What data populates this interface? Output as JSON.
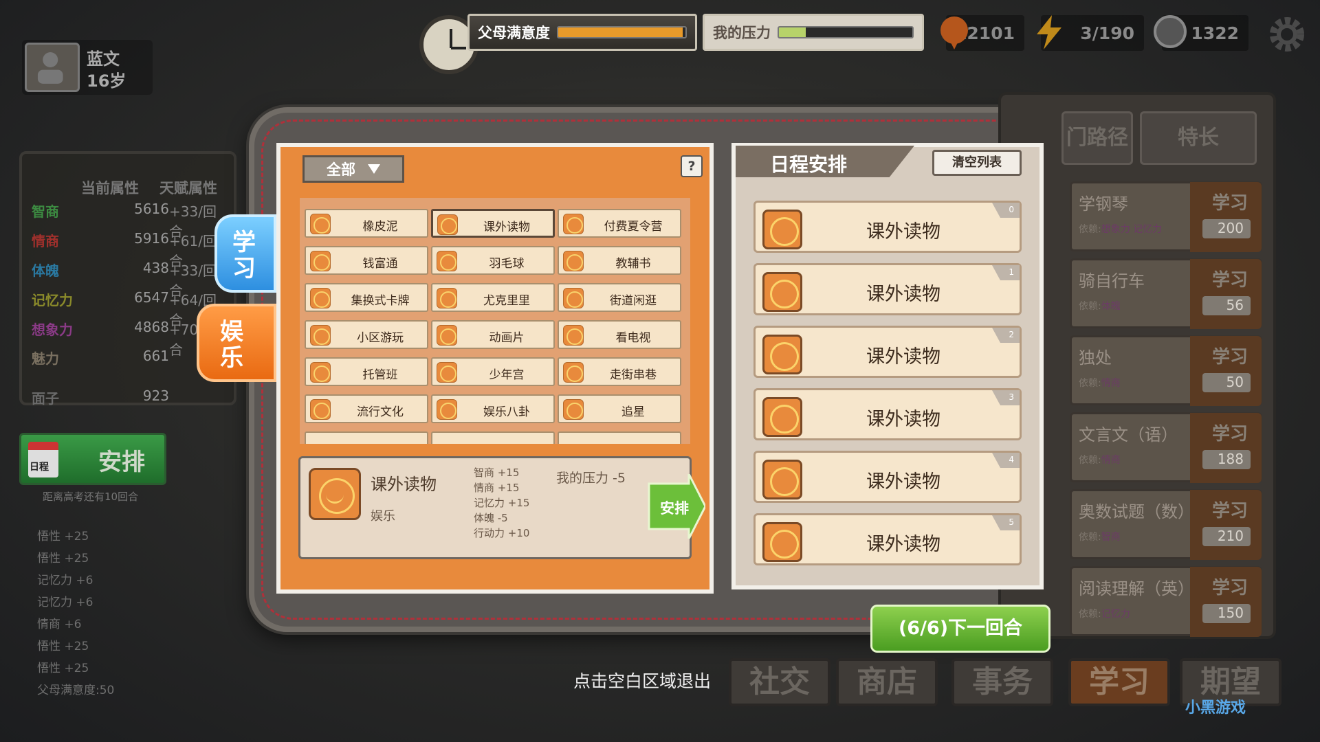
{
  "hud": {
    "parent_label": "父母满意度",
    "parent_level": 0.98,
    "stress_label": "我的压力",
    "stress_level": 0.2,
    "coins": "12101",
    "energy": "3/190",
    "money": "1322"
  },
  "player": {
    "name": "蓝文",
    "age": "16岁"
  },
  "attributes": {
    "col_current": "当前属性",
    "col_talent": "天赋属性",
    "rows": [
      {
        "name": "智商",
        "value": "5616",
        "talent": "+33/回合",
        "color": "#3c8a41"
      },
      {
        "name": "情商",
        "value": "5916",
        "talent": "+61/回合",
        "color": "#a0302c"
      },
      {
        "name": "体魄",
        "value": "438",
        "talent": "+33/回合",
        "color": "#2a78a0"
      },
      {
        "name": "记忆力",
        "value": "6547",
        "talent": "+64/回合",
        "color": "#8a8a2a"
      },
      {
        "name": "想象力",
        "value": "4868",
        "talent": "+70/回合",
        "color": "#8a3a86"
      },
      {
        "name": "魅力",
        "value": "661",
        "talent": "",
        "color": "#7a7060"
      },
      {
        "name": "面子",
        "value": "923",
        "talent": "",
        "color": "#6a6a6a"
      }
    ]
  },
  "arrange": {
    "icon_label": "日程",
    "label": "安排",
    "exam_note": "距离高考还有10回合"
  },
  "log": [
    "悟性 +25",
    "悟性 +25",
    "记忆力 +6",
    "记忆力 +6",
    "情商 +6",
    "悟性 +25",
    "悟性 +25",
    "父母满意度:50"
  ],
  "tabs": {
    "study": "学习",
    "fun": "娱乐"
  },
  "activities": {
    "filter": "全部",
    "help": "?",
    "items": [
      "橡皮泥",
      "课外读物",
      "付费夏令营",
      "钱富通",
      "羽毛球",
      "教辅书",
      "集换式卡牌",
      "尤克里里",
      "街道闲逛",
      "小区游玩",
      "动画片",
      "看电视",
      "托管班",
      "少年宫",
      "走街串巷",
      "流行文化",
      "娱乐八卦",
      "追星"
    ]
  },
  "detail": {
    "name": "课外读物",
    "category": "娱乐",
    "effects": [
      "智商 +15",
      "情商 +15",
      "记忆力 +15",
      "体魄 -5",
      "行动力 +10"
    ],
    "stress": "我的压力 -5",
    "arrange_label": "安排"
  },
  "schedule": {
    "title": "日程安排",
    "clear_label": "清空列表",
    "slots": [
      {
        "n": "0",
        "label": "课外读物"
      },
      {
        "n": "1",
        "label": "课外读物"
      },
      {
        "n": "2",
        "label": "课外读物"
      },
      {
        "n": "3",
        "label": "课外读物"
      },
      {
        "n": "4",
        "label": "课外读物"
      },
      {
        "n": "5",
        "label": "课外读物"
      }
    ]
  },
  "skill_tabs": [
    "门路径",
    "特长"
  ],
  "skills": [
    {
      "name": "学钢琴",
      "dep_label": "依赖:",
      "dep": "想象力 记忆力",
      "btn": "学习",
      "cost": "200"
    },
    {
      "name": "骑自行车",
      "dep_label": "依赖:",
      "dep": "体魄",
      "btn": "学习",
      "cost": "56"
    },
    {
      "name": "独处",
      "dep_label": "依赖:",
      "dep": "情商",
      "btn": "学习",
      "cost": "50"
    },
    {
      "name": "文言文（语）",
      "dep_label": "依赖:",
      "dep": "情商",
      "btn": "学习",
      "cost": "188"
    },
    {
      "name": "奥数试题（数）",
      "dep_label": "依赖:",
      "dep": "智商",
      "btn": "学习",
      "cost": "210"
    },
    {
      "name": "阅读理解（英）",
      "dep_label": "依赖:",
      "dep": "记忆力",
      "btn": "学习",
      "cost": "150"
    }
  ],
  "next_round": "(6/6)下一回合",
  "exit_hint": "点击空白区域退出",
  "bottom_nav": [
    "社交",
    "商店",
    "事务",
    "学习",
    "期望"
  ],
  "watermark": "小黑游戏"
}
